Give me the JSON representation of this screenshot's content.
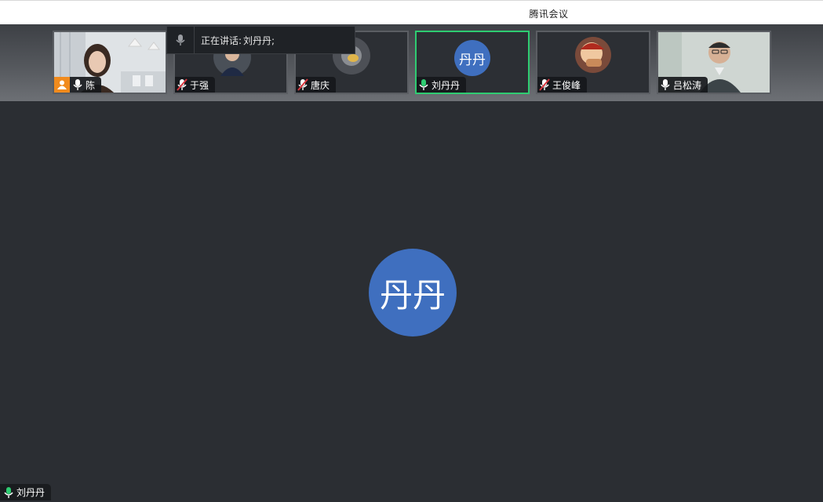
{
  "window": {
    "title": "腾讯会议"
  },
  "speaking_banner": {
    "label": "正在讲话:",
    "value": "刘丹丹;"
  },
  "participants": [
    {
      "name": "陈",
      "host": true,
      "muted": false
    },
    {
      "name": "于强",
      "muted": true
    },
    {
      "name": "唐庆",
      "muted": true
    },
    {
      "name": "刘丹丹",
      "muted": false,
      "active": true,
      "avatar_text": "丹丹"
    },
    {
      "name": "王俊峰",
      "muted": true
    },
    {
      "name": "吕松涛",
      "muted": false
    }
  ],
  "main_view": {
    "avatar_text": "丹丹",
    "speaker_name": "刘丹丹"
  },
  "colors": {
    "accent_green": "#2ecc71",
    "avatar_blue": "#3f6fbf",
    "muted_red": "#d9363e",
    "host_orange": "#f18b1d",
    "background": "#2b2e33"
  }
}
